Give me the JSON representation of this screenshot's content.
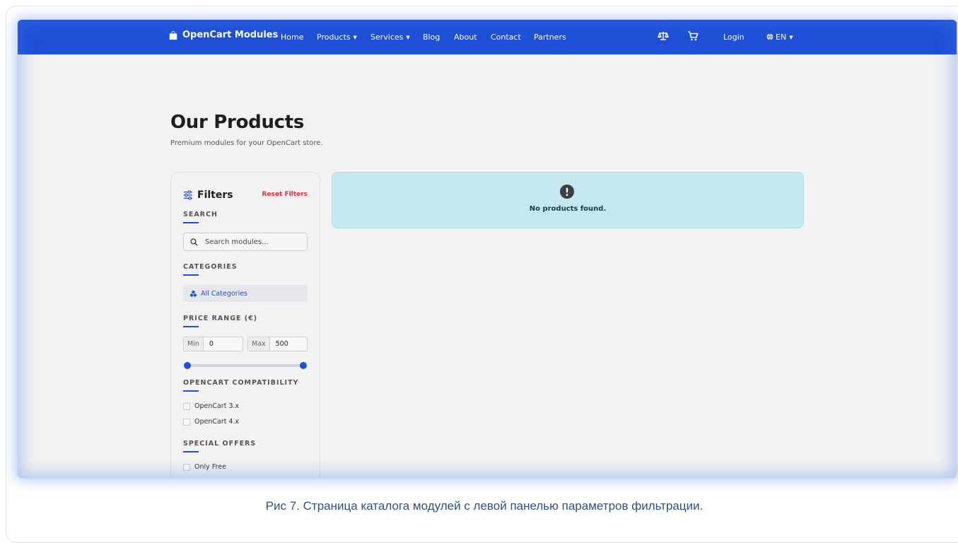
{
  "navbar": {
    "brand": "OpenCart Modules",
    "links": [
      {
        "label": "Home"
      },
      {
        "label": "Products",
        "dropdown": true
      },
      {
        "label": "Services",
        "dropdown": true
      },
      {
        "label": "Blog"
      },
      {
        "label": "About"
      },
      {
        "label": "Contact"
      },
      {
        "label": "Partners"
      }
    ],
    "compare_icon": "scale-icon",
    "cart_icon": "cart-icon",
    "login": "Login",
    "language": "EN",
    "bg_color": "#1f4fd6"
  },
  "page": {
    "title": "Our Products",
    "subtitle": "Premium modules for your OpenCart store."
  },
  "filters": {
    "title": "Filters",
    "reset_label": "Reset Filters",
    "search": {
      "title": "SEARCH",
      "placeholder": "Search modules..."
    },
    "categories": {
      "title": "CATEGORIES",
      "selected": "All Categories"
    },
    "price": {
      "title": "PRICE RANGE (€)",
      "min_label": "Min",
      "min_value": "0",
      "max_label": "Max",
      "max_value": "500"
    },
    "compatibility": {
      "title": "OPENCART COMPATIBILITY",
      "options": [
        "OpenCart 3.x",
        "OpenCart 4.x"
      ]
    },
    "offers": {
      "title": "SPECIAL OFFERS",
      "options": [
        "Only Free"
      ]
    }
  },
  "results": {
    "message": "No products found.",
    "icon": "exclamation-circle-icon",
    "alert_color": "#c5e7f0"
  },
  "caption": "Рис 7. Страница каталога модулей с левой панелью параметров фильтрации."
}
